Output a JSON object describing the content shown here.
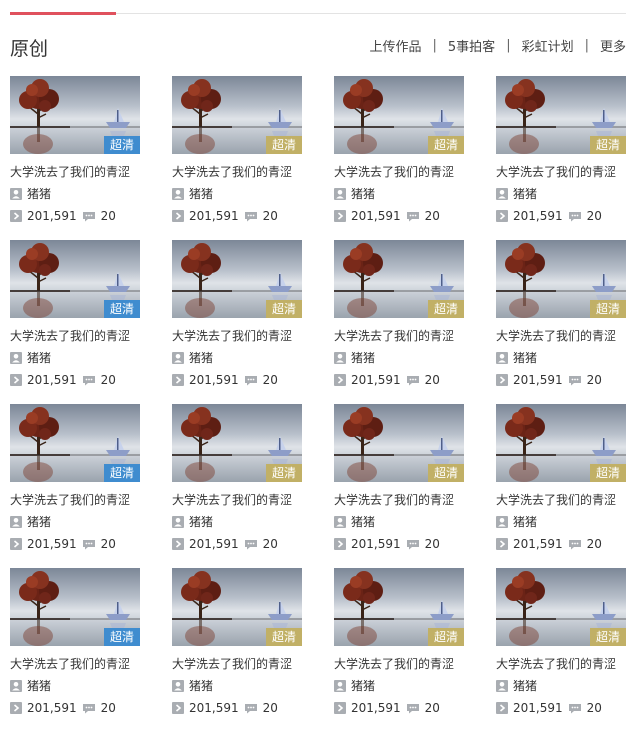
{
  "section": {
    "title": "原创",
    "nav": [
      "上传作品",
      "5事拍客",
      "彩虹计划",
      "更多"
    ]
  },
  "videos": [
    {
      "title": "大学洗去了我们的青涩",
      "author": "猪猪",
      "plays": "201,591",
      "comments": "20",
      "badge": "超清",
      "badge_color": "#3f8ccf"
    },
    {
      "title": "大学洗去了我们的青涩",
      "author": "猪猪",
      "plays": "201,591",
      "comments": "20",
      "badge": "超清",
      "badge_color": "#c1b066"
    },
    {
      "title": "大学洗去了我们的青涩",
      "author": "猪猪",
      "plays": "201,591",
      "comments": "20",
      "badge": "超清",
      "badge_color": "#c1b066"
    },
    {
      "title": "大学洗去了我们的青涩",
      "author": "猪猪",
      "plays": "201,591",
      "comments": "20",
      "badge": "超清",
      "badge_color": "#c1b066"
    },
    {
      "title": "大学洗去了我们的青涩",
      "author": "猪猪",
      "plays": "201,591",
      "comments": "20",
      "badge": "超清",
      "badge_color": "#3f8ccf"
    },
    {
      "title": "大学洗去了我们的青涩",
      "author": "猪猪",
      "plays": "201,591",
      "comments": "20",
      "badge": "超清",
      "badge_color": "#c1b066"
    },
    {
      "title": "大学洗去了我们的青涩",
      "author": "猪猪",
      "plays": "201,591",
      "comments": "20",
      "badge": "超清",
      "badge_color": "#c1b066"
    },
    {
      "title": "大学洗去了我们的青涩",
      "author": "猪猪",
      "plays": "201,591",
      "comments": "20",
      "badge": "超清",
      "badge_color": "#c1b066"
    },
    {
      "title": "大学洗去了我们的青涩",
      "author": "猪猪",
      "plays": "201,591",
      "comments": "20",
      "badge": "超清",
      "badge_color": "#3f8ccf"
    },
    {
      "title": "大学洗去了我们的青涩",
      "author": "猪猪",
      "plays": "201,591",
      "comments": "20",
      "badge": "超清",
      "badge_color": "#c1b066"
    },
    {
      "title": "大学洗去了我们的青涩",
      "author": "猪猪",
      "plays": "201,591",
      "comments": "20",
      "badge": "超清",
      "badge_color": "#c1b066"
    },
    {
      "title": "大学洗去了我们的青涩",
      "author": "猪猪",
      "plays": "201,591",
      "comments": "20",
      "badge": "超清",
      "badge_color": "#c1b066"
    },
    {
      "title": "大学洗去了我们的青涩",
      "author": "猪猪",
      "plays": "201,591",
      "comments": "20",
      "badge": "超清",
      "badge_color": "#3f8ccf"
    },
    {
      "title": "大学洗去了我们的青涩",
      "author": "猪猪",
      "plays": "201,591",
      "comments": "20",
      "badge": "超清",
      "badge_color": "#c1b066"
    },
    {
      "title": "大学洗去了我们的青涩",
      "author": "猪猪",
      "plays": "201,591",
      "comments": "20",
      "badge": "超清",
      "badge_color": "#c1b066"
    },
    {
      "title": "大学洗去了我们的青涩",
      "author": "猪猪",
      "plays": "201,591",
      "comments": "20",
      "badge": "超清",
      "badge_color": "#c1b066"
    }
  ],
  "icons": {
    "author": "user-icon",
    "plays": "play-icon",
    "comments": "comment-icon"
  },
  "colors": {
    "accent": "#e0515d",
    "badge_blue": "#3f8ccf",
    "badge_gold": "#c1b066",
    "icon_gray": "#a9adb2"
  }
}
